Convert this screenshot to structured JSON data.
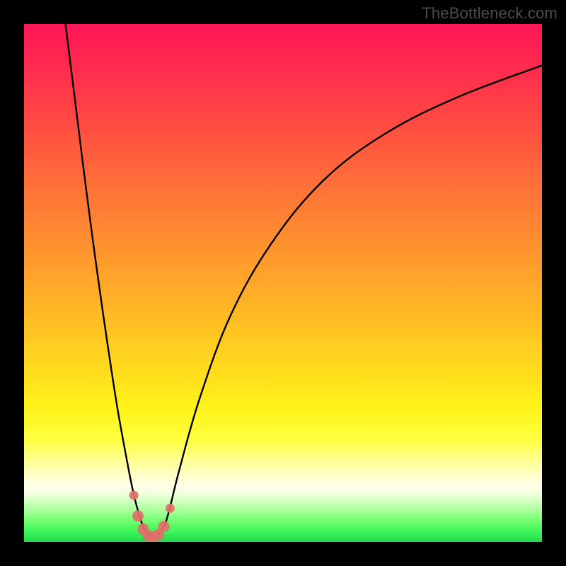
{
  "watermark": "TheBottleneck.com",
  "colors": {
    "frame": "#000000",
    "curve_stroke": "#000000",
    "marker_fill": "#e26f6a",
    "gradient_top": "#ff1556",
    "gradient_bottom": "#21d94c"
  },
  "chart_data": {
    "type": "line",
    "title": "",
    "xlabel": "",
    "ylabel": "",
    "xlim": [
      0,
      100
    ],
    "ylim": [
      0,
      100
    ],
    "grid": false,
    "legend": false,
    "background": "red-to-green vertical gradient (bottleneck heatmap)",
    "series": [
      {
        "name": "bottleneck-curve",
        "x": [
          8,
          10,
          12,
          14,
          16,
          18,
          20,
          21,
          22,
          23,
          24,
          25,
          26,
          27,
          28,
          30,
          34,
          40,
          48,
          58,
          70,
          84,
          100
        ],
        "y": [
          100,
          84,
          68,
          53,
          39,
          26,
          15,
          10,
          6,
          3,
          1.5,
          1,
          1.5,
          3,
          6,
          14,
          28,
          44,
          58,
          70,
          79,
          86,
          92
        ]
      }
    ],
    "markers": {
      "name": "highlighted-points",
      "x": [
        21.2,
        22.0,
        23.0,
        24.0,
        25.0,
        26.0,
        27.0,
        28.2
      ],
      "y": [
        9.0,
        5.0,
        2.5,
        1.2,
        1.0,
        1.4,
        3.0,
        6.5
      ]
    }
  }
}
